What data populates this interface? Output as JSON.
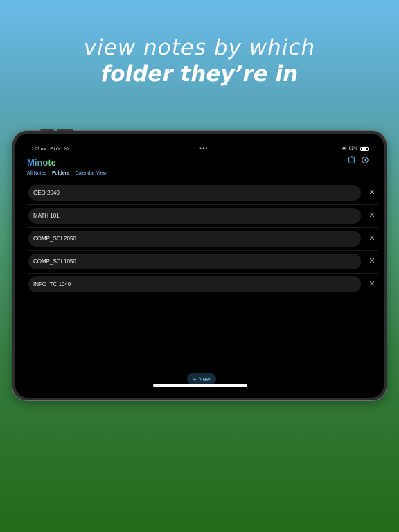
{
  "headline": {
    "line1": "view notes by which",
    "line2": "folder they’re in"
  },
  "status_bar": {
    "time": "12:03 AM",
    "date": "Fri Oct 20",
    "dots": "•••",
    "battery": "82%",
    "wifi_icon": "wifi-icon",
    "battery_icon": "battery-icon"
  },
  "app": {
    "title": "Minote",
    "title_gradient": [
      "#3a8df0",
      "#6fd56e"
    ],
    "tabs": [
      {
        "label": "All Notes",
        "active": false
      },
      {
        "label": "Folders",
        "active": true
      },
      {
        "label": "Calendar View",
        "active": false
      }
    ],
    "top_icons": [
      "clipboard-icon",
      "settings-circle-icon"
    ],
    "folders": [
      {
        "name": "GEO 2040"
      },
      {
        "name": "MATH 101"
      },
      {
        "name": "COMP_SCI 2050"
      },
      {
        "name": "COMP_SCI 1050"
      },
      {
        "name": "INFO_TC 1040"
      }
    ],
    "delete_glyph": "✕",
    "new_button": {
      "icon": "+",
      "label": "New"
    }
  },
  "colors": {
    "accent": "#8ec8f2",
    "background": "#000000",
    "row": "#1c1c1e"
  }
}
